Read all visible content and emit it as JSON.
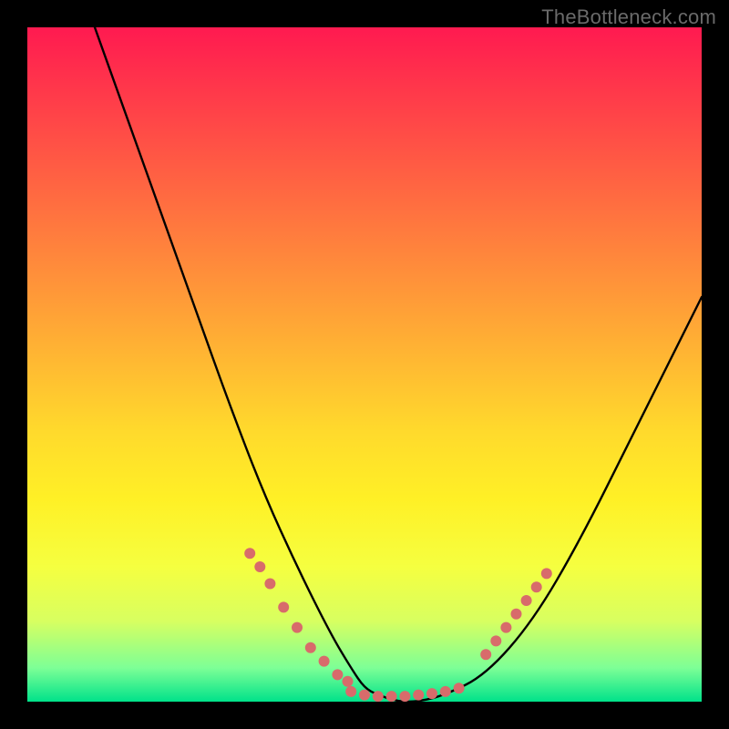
{
  "watermark": "TheBottleneck.com",
  "chart_data": {
    "type": "line",
    "title": "",
    "xlabel": "",
    "ylabel": "",
    "xlim": [
      0,
      100
    ],
    "ylim": [
      0,
      100
    ],
    "grid": false,
    "legend": false,
    "background_gradient": {
      "top": "#ff1a50",
      "mid": "#ffda2c",
      "bottom": "#00e28a",
      "meaning": "high-to-low bottleneck severity"
    },
    "series": [
      {
        "name": "bottleneck-curve",
        "color": "#000000",
        "x": [
          10,
          15,
          20,
          25,
          30,
          35,
          40,
          45,
          48,
          50,
          52,
          55,
          58,
          62,
          68,
          75,
          82,
          90,
          100
        ],
        "y": [
          100,
          86,
          72,
          58,
          44,
          31,
          20,
          10,
          5,
          2,
          1,
          0,
          0,
          1,
          4,
          12,
          24,
          40,
          60
        ]
      }
    ],
    "annotations": [
      {
        "name": "dot-cluster-left",
        "color": "#d86b6b",
        "x": [
          33,
          34.5,
          36,
          38,
          40,
          42,
          44,
          46,
          47.5
        ],
        "y": [
          22,
          20,
          17.5,
          14,
          11,
          8,
          6,
          4,
          3
        ]
      },
      {
        "name": "dot-cluster-bottom",
        "color": "#d86b6b",
        "x": [
          48,
          50,
          52,
          54,
          56,
          58,
          60,
          62,
          64
        ],
        "y": [
          1.5,
          1,
          0.8,
          0.8,
          0.8,
          1,
          1.2,
          1.5,
          2
        ]
      },
      {
        "name": "dot-cluster-right",
        "color": "#d86b6b",
        "x": [
          68,
          69.5,
          71,
          72.5,
          74,
          75.5,
          77
        ],
        "y": [
          7,
          9,
          11,
          13,
          15,
          17,
          19
        ]
      }
    ]
  }
}
